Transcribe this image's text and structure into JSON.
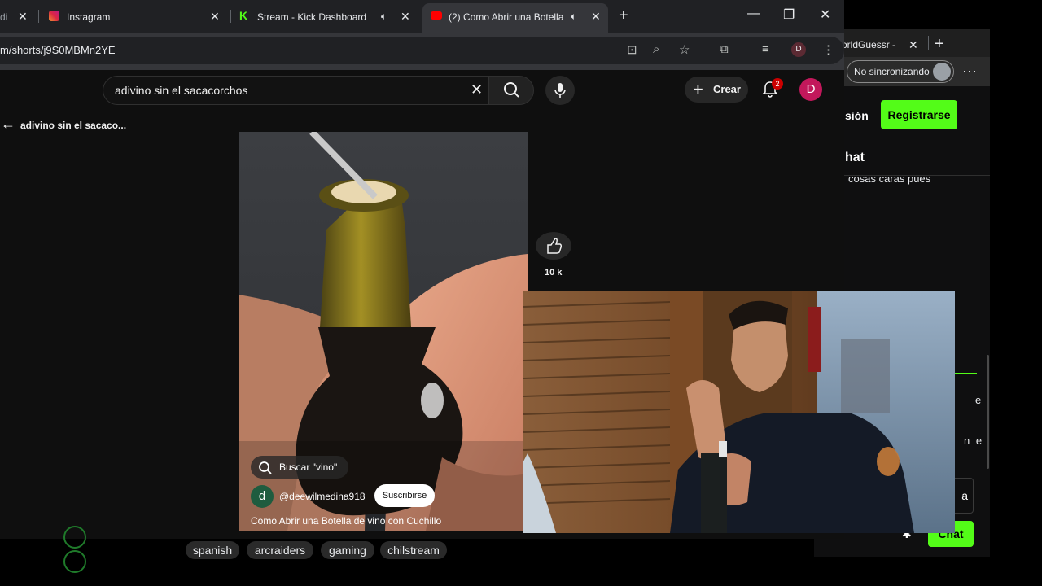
{
  "browser": {
    "tabs": [
      {
        "label": "di",
        "close": "✕"
      },
      {
        "label": "Instagram",
        "close": "✕"
      },
      {
        "label": "Stream - Kick Dashboard",
        "close": "✕"
      },
      {
        "label": "(2) Como Abrir una Botella",
        "close": "✕"
      }
    ],
    "new_tab": "+",
    "window_controls": {
      "minimize": "—",
      "restore": "❐",
      "close": "✕"
    },
    "url": "m/shorts/j9S0MBMn2YE",
    "profile_initial": "D"
  },
  "youtube": {
    "search_query": "adivino sin el sacacorchos",
    "create_label": "Crear",
    "notification_count": "2",
    "avatar_initial": "D",
    "back_label": "adivino sin el sacaco...",
    "like_count": "10 k",
    "search_chip": "Buscar \"vino\"",
    "channel_initial": "d",
    "channel_handle": "@deewilmedina918",
    "subscribe_label": "Suscribirse",
    "video_title": "Como Abrir una Botella de vino con Cuchillo"
  },
  "back_window": {
    "tab_label": "orldGuessr -",
    "sync_label": "No sincronizando",
    "login_fragment": "sión",
    "register_label": "Registrarse",
    "chat_title": "hat",
    "chat_message": "cosas caras pues",
    "fragment_e": "e",
    "fragment_ne": "n e",
    "input_char": "a",
    "chat_button": "Chat"
  },
  "stream_tags": [
    "spanish",
    "arcraiders",
    "gaming",
    "chilstream"
  ],
  "colors": {
    "kick_green": "#53fc18",
    "youtube_red": "#ff0000",
    "avatar_pink": "#c2185b"
  }
}
